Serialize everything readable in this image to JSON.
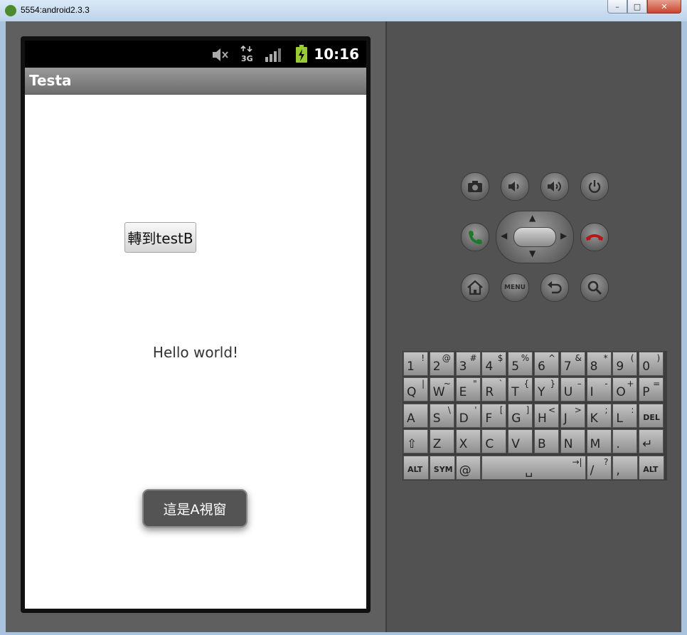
{
  "window": {
    "title": "5554:android2.3.3",
    "controls": [
      "–",
      "□",
      "✕"
    ]
  },
  "status_bar": {
    "time": "10:16",
    "network": "3G",
    "icons": [
      "mute-icon",
      "3g-data-icon",
      "signal-icon",
      "battery-charging-icon"
    ]
  },
  "app": {
    "title": "Testa",
    "button_label": "轉到testB",
    "hello_text": "Hello world!",
    "toast_text": "這是A視窗"
  },
  "hardware_buttons": {
    "row1": [
      "camera-icon",
      "volume-down-icon",
      "volume-up-icon",
      "power-icon"
    ],
    "row2": [
      "call-icon",
      "dpad",
      "end-call-icon"
    ],
    "row3": [
      "home-icon",
      "menu-button",
      "back-icon",
      "search-icon"
    ],
    "menu_label": "MENU"
  },
  "keyboard": {
    "row1": [
      [
        "1",
        "!"
      ],
      [
        "2",
        "@"
      ],
      [
        "3",
        "#"
      ],
      [
        "4",
        "$"
      ],
      [
        "5",
        "%"
      ],
      [
        "6",
        "^"
      ],
      [
        "7",
        "&"
      ],
      [
        "8",
        "*"
      ],
      [
        "9",
        "("
      ],
      [
        "0",
        ")"
      ]
    ],
    "row2": [
      [
        "Q",
        "|"
      ],
      [
        "W",
        "~"
      ],
      [
        "E",
        "\""
      ],
      [
        "R",
        "`"
      ],
      [
        "T",
        "{"
      ],
      [
        "Y",
        "}"
      ],
      [
        "U",
        "–"
      ],
      [
        "I",
        "-"
      ],
      [
        "O",
        "+"
      ],
      [
        "P",
        "="
      ]
    ],
    "row3": [
      [
        "A",
        ""
      ],
      [
        "S",
        "\\"
      ],
      [
        "D",
        "'"
      ],
      [
        "F",
        "["
      ],
      [
        "G",
        "]"
      ],
      [
        "H",
        "<"
      ],
      [
        "J",
        ">"
      ],
      [
        "K",
        ";"
      ],
      [
        "L",
        ":"
      ],
      [
        "DEL",
        ""
      ]
    ],
    "row4": [
      [
        "⇧",
        ""
      ],
      [
        "Z",
        ""
      ],
      [
        "X",
        ""
      ],
      [
        "C",
        ""
      ],
      [
        "V",
        ""
      ],
      [
        "B",
        ""
      ],
      [
        "N",
        ""
      ],
      [
        "M",
        ""
      ],
      [
        ".",
        ""
      ],
      [
        "↵",
        ""
      ]
    ],
    "row5": [
      [
        "ALT",
        ""
      ],
      [
        "SYM",
        ""
      ],
      [
        "@",
        ""
      ],
      [
        "␣",
        "→|"
      ],
      [
        "/",
        "?"
      ],
      [
        ",",
        ""
      ],
      [
        "ALT",
        ""
      ]
    ]
  }
}
